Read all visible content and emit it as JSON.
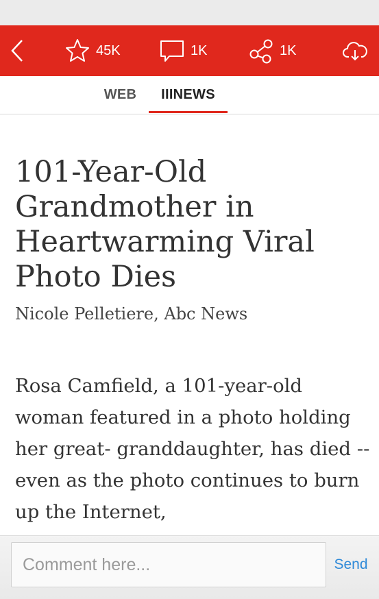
{
  "toolbar": {
    "back_icon": "chevron-left-icon",
    "favorites": {
      "icon": "star-icon",
      "count": "45K"
    },
    "comments": {
      "icon": "speech-bubble-icon",
      "count": "1K"
    },
    "shares": {
      "icon": "share-icon",
      "count": "1K"
    },
    "download_icon": "cloud-download-icon",
    "color": "#e0281d"
  },
  "tabs": [
    {
      "label": "WEB",
      "active": false
    },
    {
      "label": "IIINEWS",
      "active": true
    }
  ],
  "article": {
    "headline": "101-Year-Old Grandmother in Heartwarming Viral Photo Dies",
    "byline": "Nicole Pelletiere, Abc News",
    "body": "Rosa Camfield, a 101-year-old woman featured in a photo holding her great- granddaughter, has died -- even as the photo continues to burn up the Internet,"
  },
  "comment": {
    "placeholder": "Comment here...",
    "send_label": "Send",
    "send_color": "#2f8ad8"
  }
}
